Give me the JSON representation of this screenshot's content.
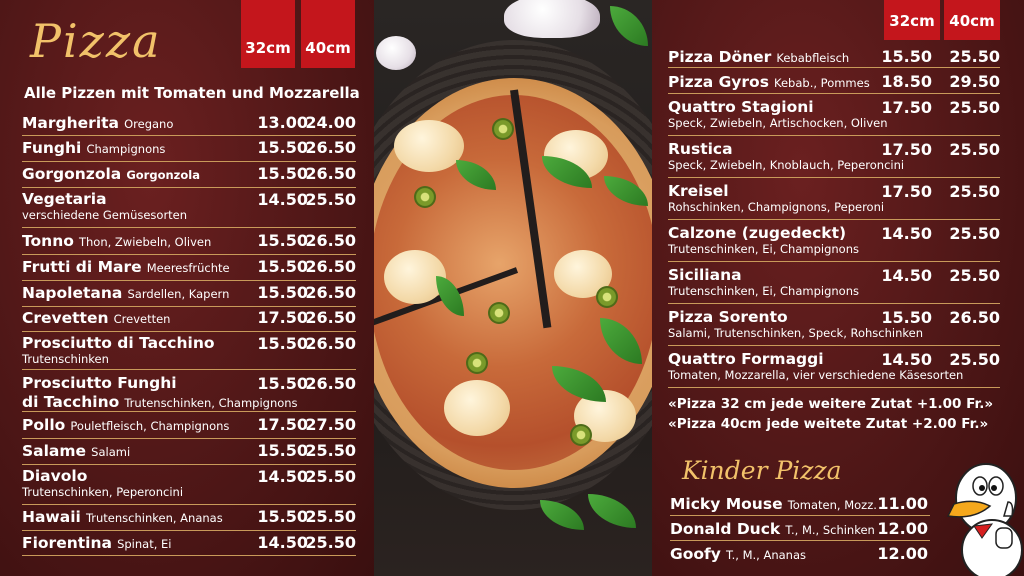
{
  "title": "Pizza",
  "size_small": "32cm",
  "size_large": "40cm",
  "subtitle": "Alle Pizzen mit Tomaten und Mozzarella",
  "left_items": [
    {
      "name": "Margherita",
      "desc": "Oregano",
      "p1": "13.00",
      "p2": "24.00"
    },
    {
      "name": "Funghi",
      "desc": "Champignons",
      "p1": "15.50",
      "p2": "26.50"
    },
    {
      "name": "Gorgonzola",
      "desc": "Gorgonzola",
      "p1": "15.50",
      "p2": "26.50"
    },
    {
      "name": "Vegetaria",
      "desc": "verschiedene Gemüsesorten",
      "p1": "14.50",
      "p2": "25.50"
    },
    {
      "name": "Tonno",
      "desc": "Thon, Zwiebeln, Oliven",
      "p1": "15.50",
      "p2": "26.50"
    },
    {
      "name": "Frutti di Mare",
      "desc": "Meeresfrüchte",
      "p1": "15.50",
      "p2": "26.50"
    },
    {
      "name": "Napoletana",
      "desc": "Sardellen, Kapern",
      "p1": "15.50",
      "p2": "26.50"
    },
    {
      "name": "Crevetten",
      "desc": "Crevetten",
      "p1": "17.50",
      "p2": "26.50"
    },
    {
      "name": "Prosciutto di Tacchino",
      "desc": "Trutenschinken",
      "p1": "15.50",
      "p2": "26.50"
    },
    {
      "name": "Prosciutto Funghi",
      "name2": "di Tacchino",
      "desc": "Trutenschinken, Champignons",
      "p1": "15.50",
      "p2": "26.50"
    },
    {
      "name": "Pollo",
      "desc": "Pouletfleisch, Champignons",
      "p1": "17.50",
      "p2": "27.50"
    },
    {
      "name": "Salame",
      "desc": "Salami",
      "p1": "15.50",
      "p2": "25.50"
    },
    {
      "name": "Diavolo",
      "desc": "Trutenschinken, Peperoncini",
      "p1": "14.50",
      "p2": "25.50"
    },
    {
      "name": "Hawaii",
      "desc": "Trutenschinken, Ananas",
      "p1": "15.50",
      "p2": "25.50"
    },
    {
      "name": "Fiorentina",
      "desc": "Spinat, Ei",
      "p1": "14.50",
      "p2": "25.50"
    }
  ],
  "right_items": [
    {
      "name": "Pizza Döner",
      "desc": "Kebabfleisch",
      "p1": "15.50",
      "p2": "25.50"
    },
    {
      "name": "Pizza Gyros",
      "desc": "Kebab., Pommes",
      "p1": "18.50",
      "p2": "29.50"
    },
    {
      "name": "Quattro Stagioni",
      "desc": "Speck, Zwiebeln, Artischocken, Oliven",
      "p1": "17.50",
      "p2": "25.50"
    },
    {
      "name": "Rustica",
      "desc": "Speck, Zwiebeln, Knoblauch, Peperoncini",
      "p1": "17.50",
      "p2": "25.50"
    },
    {
      "name": "Kreisel",
      "desc": "Rohschinken, Champignons, Peperoni",
      "p1": "17.50",
      "p2": "25.50"
    },
    {
      "name": "Calzone (zugedeckt)",
      "desc": "Trutenschinken, Ei, Champignons",
      "p1": "14.50",
      "p2": "25.50"
    },
    {
      "name": "Siciliana",
      "desc": "Trutenschinken, Ei, Champignons",
      "p1": "14.50",
      "p2": "25.50"
    },
    {
      "name": "Pizza Sorento",
      "desc": "Salami, Trutenschinken, Speck, Rohschinken",
      "p1": "15.50",
      "p2": "26.50"
    },
    {
      "name": "Quattro Formaggi",
      "desc": "Tomaten, Mozzarella, vier verschiedene Käsesorten",
      "p1": "14.50",
      "p2": "25.50"
    }
  ],
  "note1": "«Pizza 32 cm jede weitere Zutat +1.00 Fr.»",
  "note2": "«Pizza 40cm jede weitete Zutat +2.00 Fr.»",
  "kinder_title": "Kinder Pizza",
  "kinder_items": [
    {
      "name": "Micky Mouse",
      "desc": "Tomaten, Mozz.",
      "p1": "11.00"
    },
    {
      "name": "Donald Duck",
      "desc": "T., M., Schinken",
      "p1": "12.00"
    },
    {
      "name": "Goofy",
      "desc": "T., M., Ananas",
      "p1": "12.00"
    }
  ],
  "colors": {
    "panel": "#4f1717",
    "accent_red": "#c4161c",
    "gold": "#f2c26a"
  }
}
